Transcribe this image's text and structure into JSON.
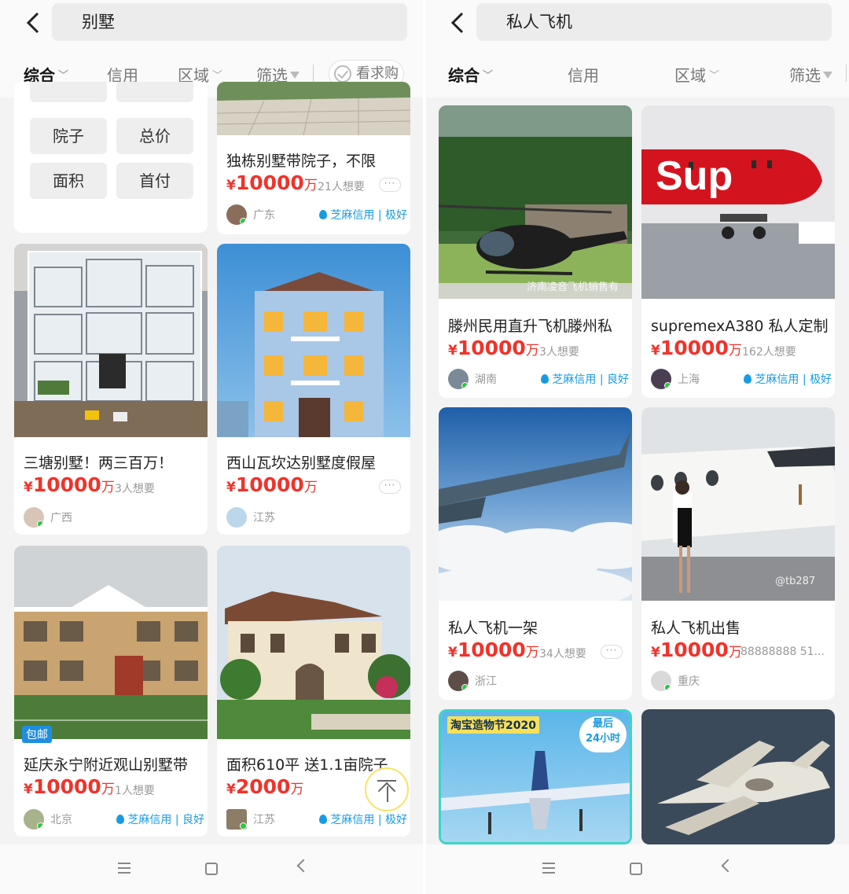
{
  "left": {
    "search": "别墅",
    "tabs": {
      "t1": "综合",
      "t2": "信用",
      "t3": "区域",
      "t4": "筛选",
      "want_btn": "看求购"
    },
    "filter_tags": [
      "院子",
      "总价",
      "面积",
      "首付"
    ],
    "cards": [
      {
        "title": "独栋别墅带院子，不限",
        "yen": "¥",
        "price": "10000",
        "unit": "万",
        "want": "21人想要",
        "loc": "广东",
        "credit": "芝麻信用 | 极好"
      },
      {
        "title": "三塘别墅！两三百万！",
        "yen": "¥",
        "price": "10000",
        "unit": "万",
        "want": "3人想要",
        "loc": "广西",
        "credit": ""
      },
      {
        "title": "西山瓦坎达别墅度假屋",
        "yen": "¥",
        "price": "10000",
        "unit": "万",
        "want": "",
        "loc": "江苏",
        "credit": ""
      },
      {
        "title": "延庆永宁附近观山别墅带",
        "yen": "¥",
        "price": "10000",
        "unit": "万",
        "want": "1人想要",
        "loc": "北京",
        "credit": "芝麻信用 | 良好",
        "badge": "包邮"
      },
      {
        "title": "面积610平 送1.1亩院子",
        "yen": "¥",
        "price": "2000",
        "unit": "万",
        "want": "",
        "loc": "江苏",
        "credit": "芝麻信用 | 极好"
      }
    ]
  },
  "right": {
    "search": "私人飞机",
    "tabs": {
      "t1": "综合",
      "t2": "信用",
      "t3": "区域",
      "t4": "筛选"
    },
    "cards": [
      {
        "title": "滕州民用直升飞机滕州私",
        "yen": "¥",
        "price": "10000",
        "unit": "万",
        "want": "3人想要",
        "loc": "湖南",
        "credit": "芝麻信用 | 良好",
        "watermark": "济南凌音飞机销售有"
      },
      {
        "title": "supremexA380 私人定制",
        "yen": "¥",
        "price": "10000",
        "unit": "万",
        "want": "162人想要",
        "loc": "上海",
        "credit": "芝麻信用 | 极好",
        "logo": "Sup"
      },
      {
        "title": "私人飞机一架",
        "yen": "¥",
        "price": "10000",
        "unit": "万",
        "want": "34人想要",
        "loc": "浙江",
        "credit": ""
      },
      {
        "title": "私人飞机出售",
        "yen": "¥",
        "price": "10000",
        "unit": "万",
        "want": "88888888 51...",
        "loc": "重庆",
        "credit": "",
        "watermark": "@tb287"
      },
      {
        "promo": "淘宝造物节2020",
        "promo_badge": "最后\n24小时"
      }
    ]
  },
  "icons": {
    "back": "chevron-left-icon",
    "filter": "funnel-icon",
    "more": "ellipsis-icon",
    "to_top": "arrow-up-to-top-icon"
  },
  "colors": {
    "price": "#f0332b",
    "credit": "#1a9be0",
    "badge": "#1e8fe0"
  }
}
